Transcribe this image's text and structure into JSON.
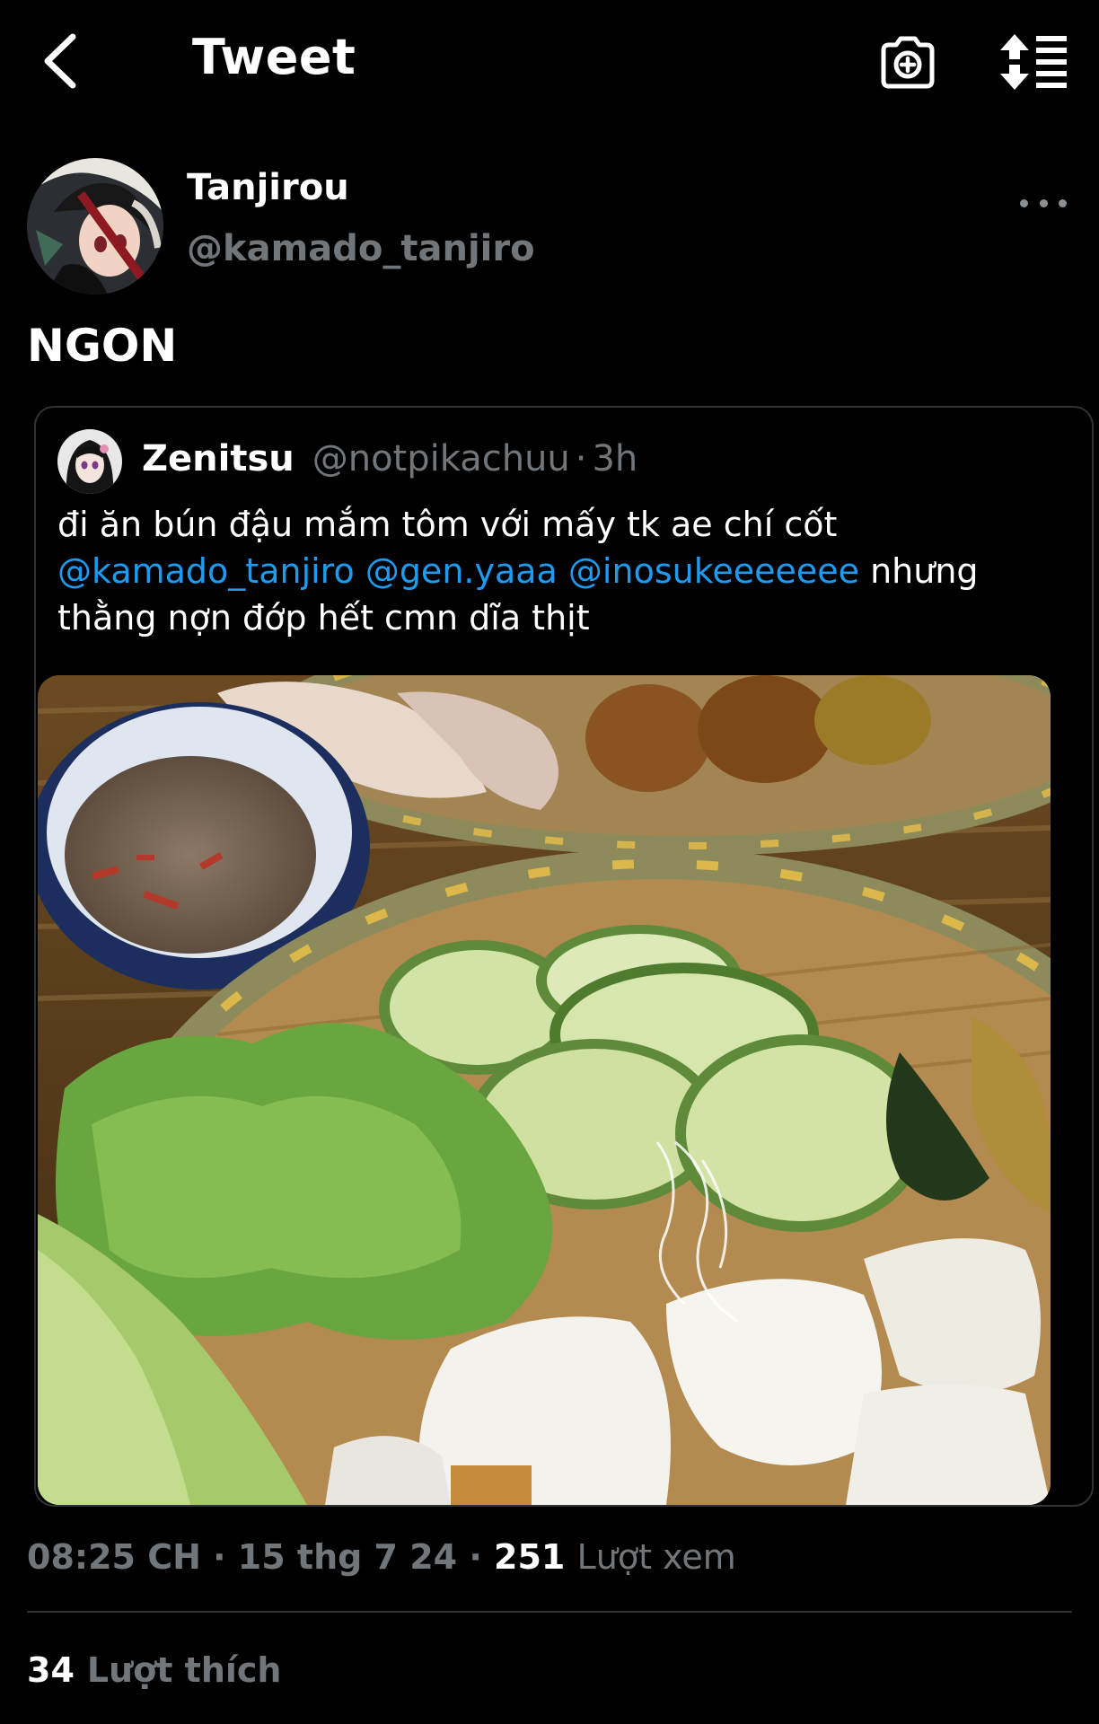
{
  "header": {
    "title": "Tweet",
    "back_icon": "chevron-left-icon",
    "camera_icon": "camera-plus-icon",
    "sort_icon": "sort-lines-icon"
  },
  "tweet": {
    "author": {
      "name": "Tanjirou",
      "handle": "@kamado_tanjiro"
    },
    "text": "NGON",
    "timestamp": "08:25 CH",
    "date": "15 thg 7 24",
    "views_count": "251",
    "views_label": "Lượt xem",
    "likes_count": "34",
    "likes_label": "Lượt thích"
  },
  "quoted_tweet": {
    "author": {
      "name": "Zenitsu",
      "handle": "@notpikachuu"
    },
    "separator": "·",
    "time": "3h",
    "text_line1": "đi ăn bún đậu mắm tôm với mấy tk ae chí cốt",
    "mention1": "@kamado_tanjiro",
    "mention2": "@gen.yaaa",
    "mention3": "@inosukeeeeeee",
    "text_after_mentions": "nhưng",
    "text_line3": "thằng nợn đớp hết cmn dĩa thịt"
  },
  "colors": {
    "background": "#000000",
    "text_primary": "#ffffff",
    "text_secondary": "#71767b",
    "link": "#1d9bf0",
    "border": "#2f3336"
  }
}
